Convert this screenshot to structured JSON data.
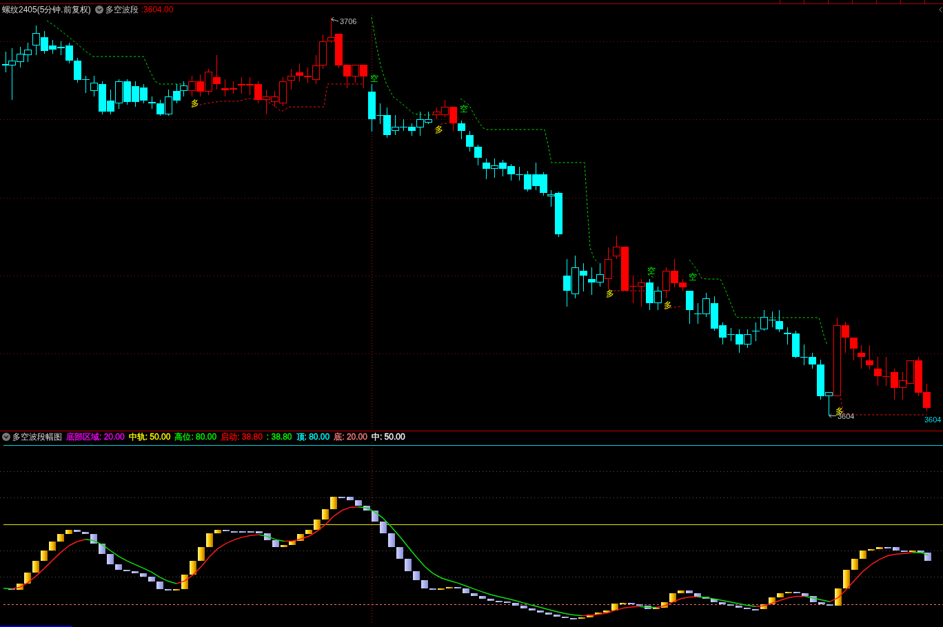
{
  "main_panel": {
    "symbol": "螺纹2405(5分钟.前复权)",
    "indicator": {
      "name": "多空波段",
      "value": ":3604.00"
    },
    "annotations": [
      {
        "kind": "high",
        "text": "3706"
      },
      {
        "kind": "low",
        "text": "3604"
      },
      {
        "kind": "last",
        "text": "3604"
      }
    ],
    "signals": [
      {
        "kind": "long",
        "text": "多"
      },
      {
        "kind": "short",
        "text": "空"
      },
      {
        "kind": "long",
        "text": "多"
      },
      {
        "kind": "short",
        "text": "空"
      },
      {
        "kind": "long",
        "text": "多"
      },
      {
        "kind": "short",
        "text": "空"
      },
      {
        "kind": "long",
        "text": "多"
      },
      {
        "kind": "short",
        "text": "空"
      },
      {
        "kind": "long",
        "text": "多"
      }
    ]
  },
  "sub_panel": {
    "indicator": "多空波段幅图",
    "legend": [
      {
        "text": "底部区域: 20.00",
        "color": "#ff00ff"
      },
      {
        "text": "中轨: 50.00",
        "color": "#ffff00"
      },
      {
        "text": "高位: 80.00",
        "color": "#00ff00"
      },
      {
        "text": "启动: 38.80",
        "color": "#ff0000"
      },
      {
        "text": ": 38.80",
        "color": "#00ff00"
      },
      {
        "text": "顶: 80.00",
        "color": "#00ffff"
      },
      {
        "text": "底: 20.00",
        "color": "#ff8080"
      },
      {
        "text": "中: 50.00",
        "color": "#ffffff"
      }
    ]
  }
}
